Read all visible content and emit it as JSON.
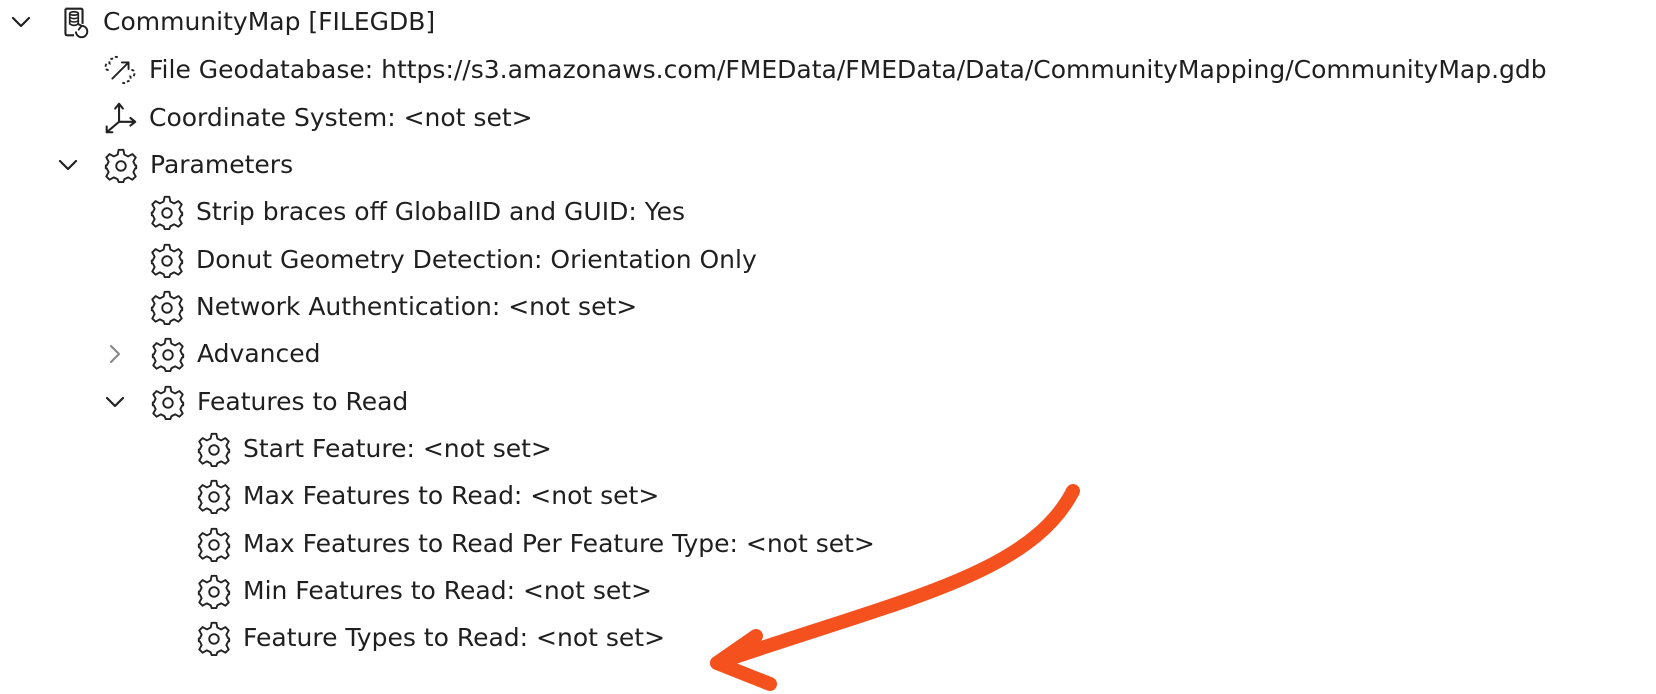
{
  "tree": {
    "root_label": "CommunityMap [FILEGDB]",
    "file_geodatabase_label": "File Geodatabase: https://s3.amazonaws.com/FMEData/FMEData/Data/CommunityMapping/CommunityMap.gdb",
    "coordinate_system_label": "Coordinate System: <not set>",
    "parameters_label": "Parameters",
    "strip_braces_label": "Strip braces off GlobalID and GUID: Yes",
    "donut_geometry_label": "Donut Geometry Detection: Orientation Only",
    "network_auth_label": "Network Authentication: <not set>",
    "advanced_label": "Advanced",
    "features_to_read_label": "Features to Read",
    "start_feature_label": "Start Feature: <not set>",
    "max_features_label": "Max Features to Read: <not set>",
    "max_features_per_type_label": "Max Features to Read Per Feature Type: <not set>",
    "min_features_label": "Min Features to Read: <not set>",
    "feature_types_label": "Feature Types to Read: <not set>"
  },
  "icons": {
    "database": "database-icon",
    "dataset": "dataset-icon",
    "coordinate": "coordinate-axes-icon",
    "gear": "gear-icon",
    "expanded": "chevron-down-icon",
    "collapsed": "chevron-right-icon"
  },
  "annotation": {
    "arrow_color": "#F4511E"
  }
}
